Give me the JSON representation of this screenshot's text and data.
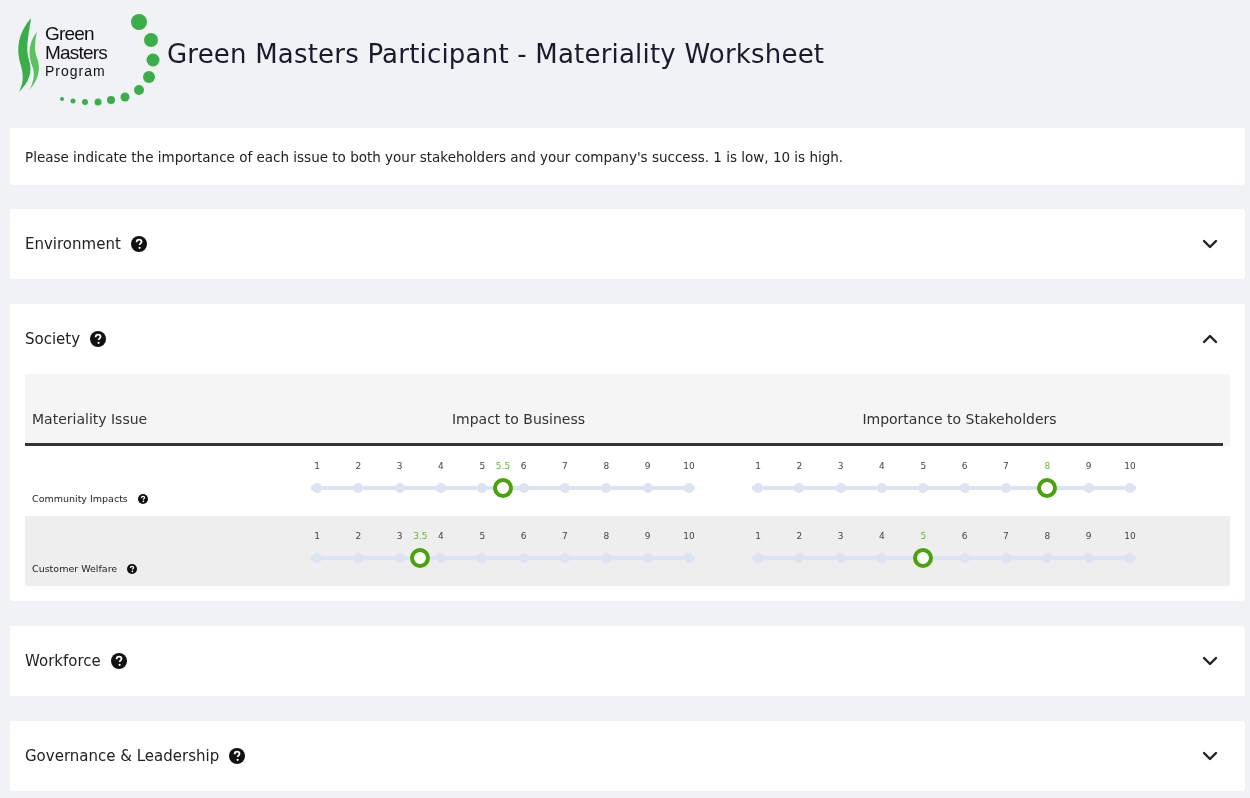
{
  "header": {
    "logo": {
      "line_1": "Green",
      "line_2": "Masters",
      "line_3": "Program"
    },
    "title": "Green Masters Participant - Materiality Worksheet"
  },
  "instructions": "Please indicate the importance of each issue to both your stakeholders and your company's success. 1 is low, 10 is high.",
  "sections": [
    {
      "title": "Environment",
      "expanded": false
    },
    {
      "title": "Society",
      "expanded": true,
      "table": {
        "columns": [
          "Materiality Issue",
          "Impact to Business",
          "Importance to Stakeholders"
        ],
        "rows": [
          {
            "issue": "Community Impacts",
            "sliders": [
              {
                "level": 0.5,
                "value_label": "5.5",
                "ticks": [
                  {
                    "label": "1",
                    "selected": false
                  },
                  {
                    "label": "2",
                    "selected": false
                  },
                  {
                    "label": "3",
                    "selected": false
                  },
                  {
                    "label": "4",
                    "selected": false
                  },
                  {
                    "label": "5",
                    "selected": false
                  },
                  {
                    "label": "6",
                    "selected": false
                  },
                  {
                    "label": "7",
                    "selected": false
                  },
                  {
                    "label": "8",
                    "selected": false
                  },
                  {
                    "label": "9",
                    "selected": false
                  },
                  {
                    "label": "10",
                    "selected": false
                  }
                ]
              },
              {
                "level": 0.7778,
                "ticks": [
                  {
                    "label": "1",
                    "selected": false
                  },
                  {
                    "label": "2",
                    "selected": false
                  },
                  {
                    "label": "3",
                    "selected": false
                  },
                  {
                    "label": "4",
                    "selected": false
                  },
                  {
                    "label": "5",
                    "selected": false
                  },
                  {
                    "label": "6",
                    "selected": false
                  },
                  {
                    "label": "7",
                    "selected": false
                  },
                  {
                    "label": "8",
                    "selected": true
                  },
                  {
                    "label": "9",
                    "selected": false
                  },
                  {
                    "label": "10",
                    "selected": false
                  }
                ]
              }
            ]
          },
          {
            "issue": "Customer Welfare",
            "sliders": [
              {
                "level": 0.2778,
                "value_label": "3.5",
                "ticks": [
                  {
                    "label": "1",
                    "selected": false
                  },
                  {
                    "label": "2",
                    "selected": false
                  },
                  {
                    "label": "3",
                    "selected": false
                  },
                  {
                    "label": "4",
                    "selected": false
                  },
                  {
                    "label": "5",
                    "selected": false
                  },
                  {
                    "label": "6",
                    "selected": false
                  },
                  {
                    "label": "7",
                    "selected": false
                  },
                  {
                    "label": "8",
                    "selected": false
                  },
                  {
                    "label": "9",
                    "selected": false
                  },
                  {
                    "label": "10",
                    "selected": false
                  }
                ]
              },
              {
                "level": 0.4444,
                "ticks": [
                  {
                    "label": "1",
                    "selected": false
                  },
                  {
                    "label": "2",
                    "selected": false
                  },
                  {
                    "label": "3",
                    "selected": false
                  },
                  {
                    "label": "4",
                    "selected": false
                  },
                  {
                    "label": "5",
                    "selected": true
                  },
                  {
                    "label": "6",
                    "selected": false
                  },
                  {
                    "label": "7",
                    "selected": false
                  },
                  {
                    "label": "8",
                    "selected": false
                  },
                  {
                    "label": "9",
                    "selected": false
                  },
                  {
                    "label": "10",
                    "selected": false
                  }
                ]
              }
            ]
          }
        ]
      }
    },
    {
      "title": "Workforce",
      "expanded": false
    },
    {
      "title": "Governance & Leadership",
      "expanded": false
    }
  ]
}
